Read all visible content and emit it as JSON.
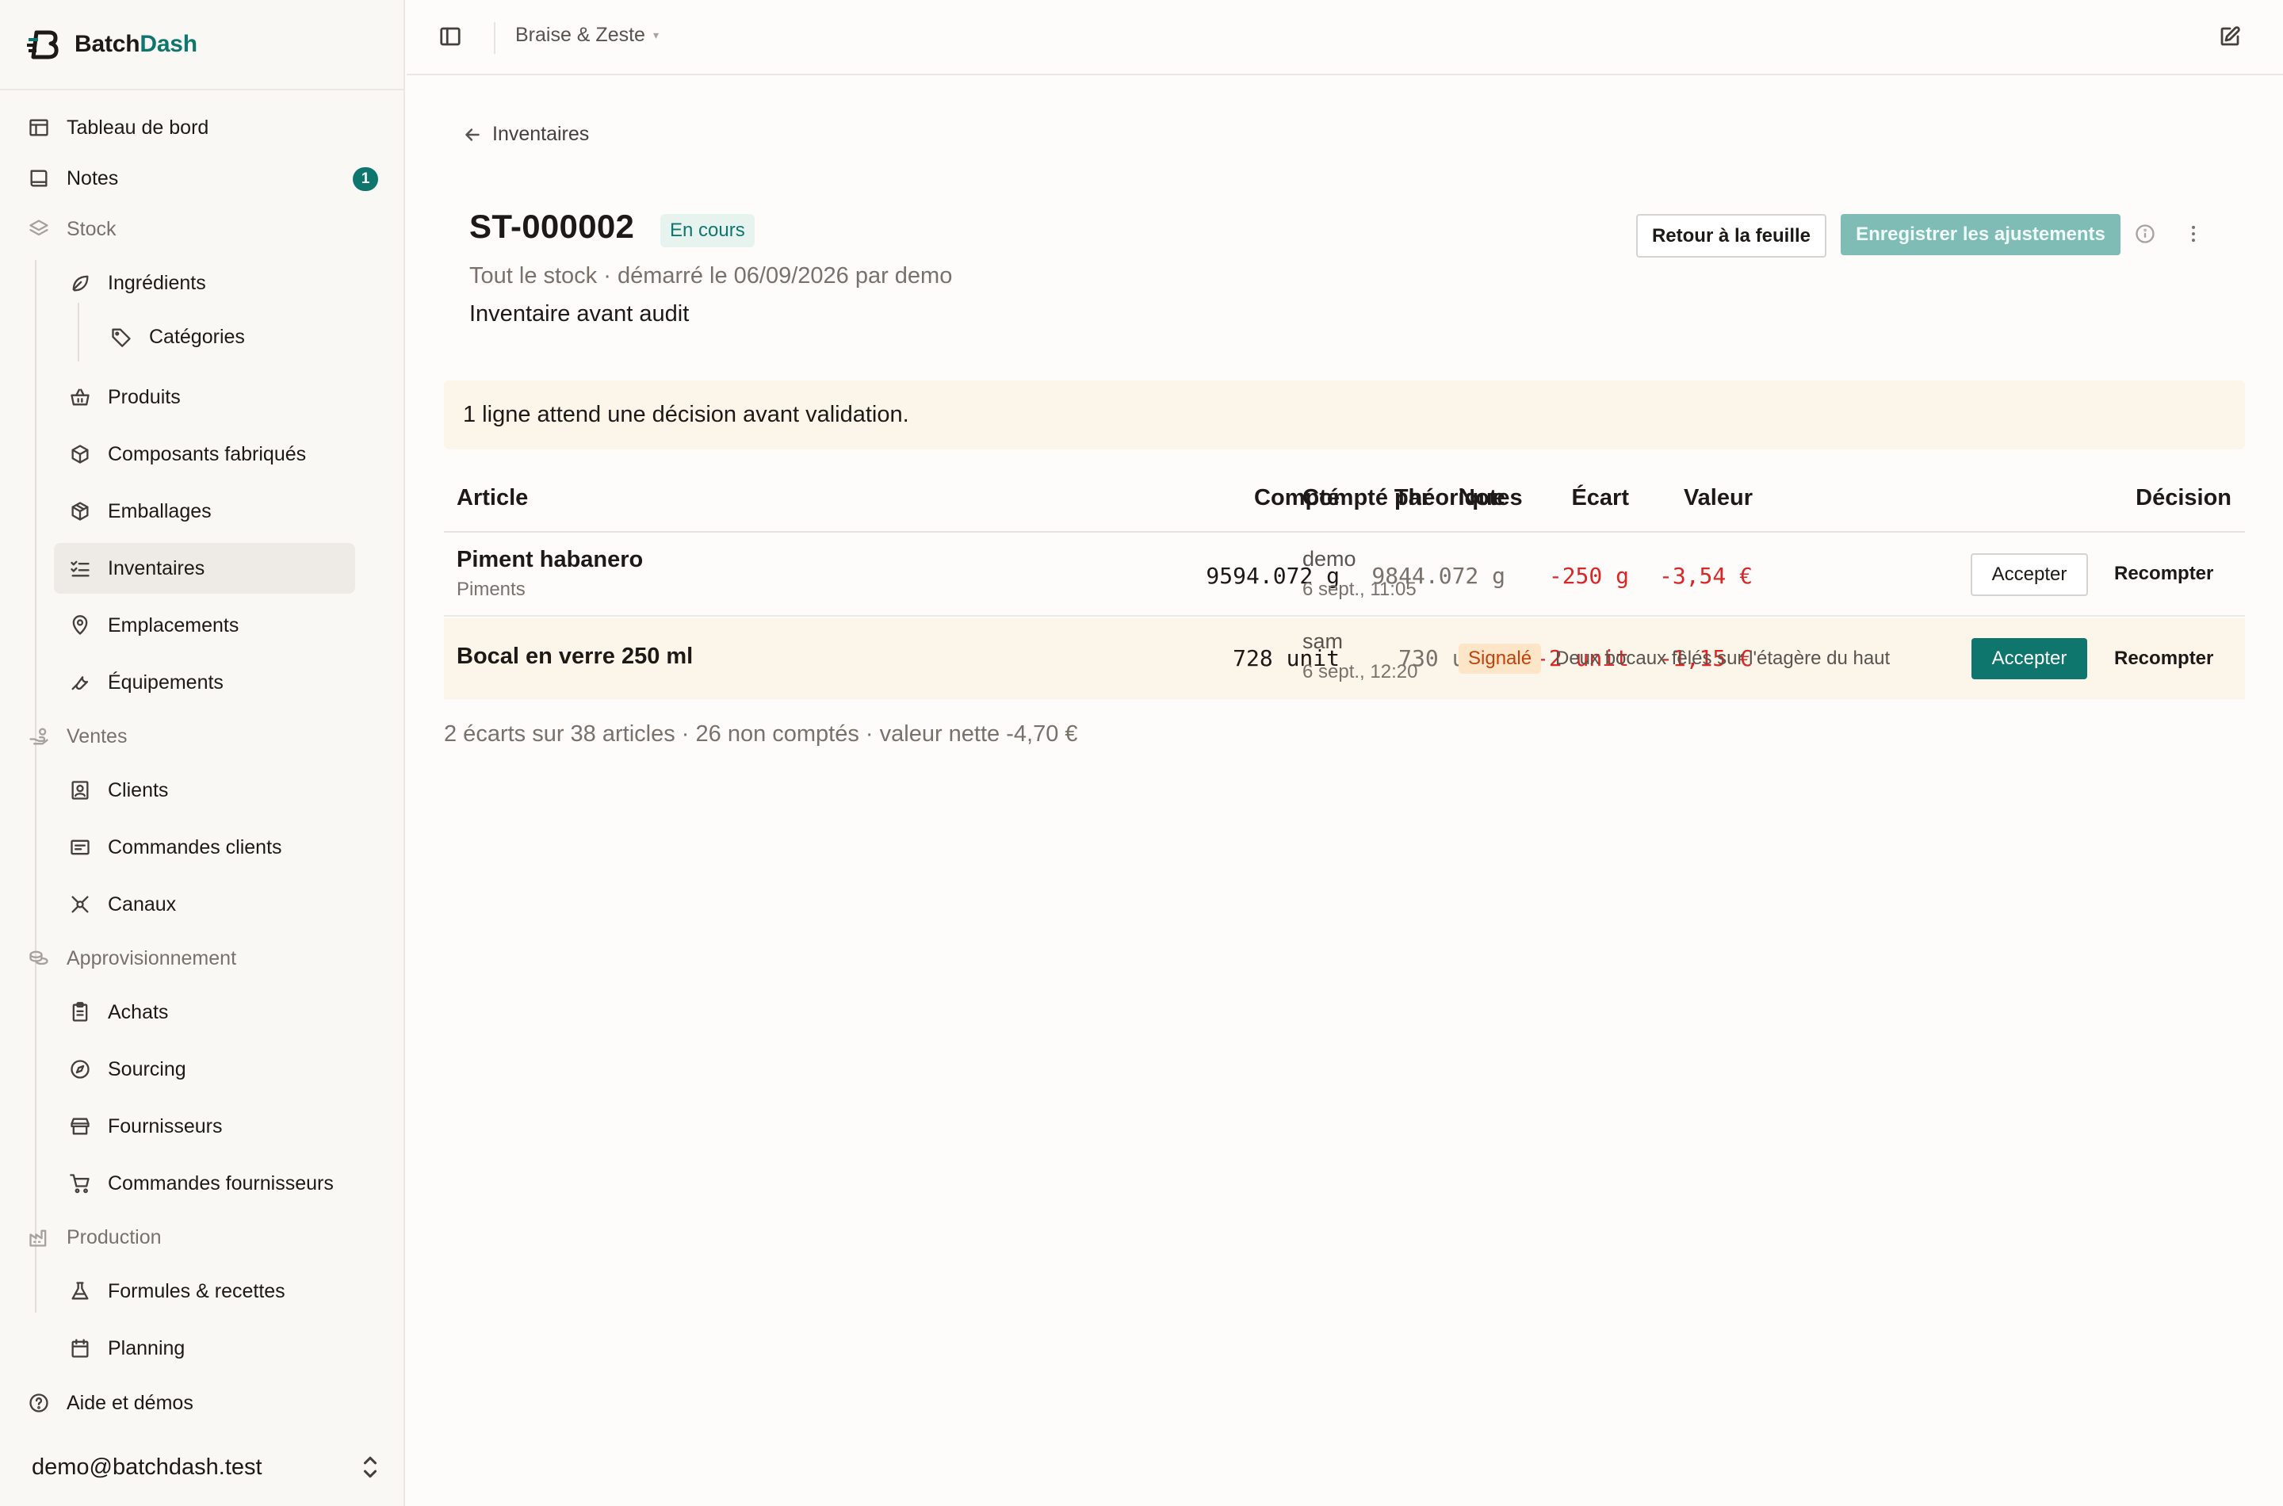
{
  "app": {
    "brand_part1": "Batch",
    "brand_part2": "Dash",
    "accent_color": "#0f766e"
  },
  "sidebar": {
    "dashboard": "Tableau de bord",
    "notes": "Notes",
    "notes_count": "1",
    "stock_section": "Stock",
    "ingredients": "Ingrédients",
    "categories": "Catégories",
    "products": "Produits",
    "components": "Composants fabriqués",
    "packaging": "Emballages",
    "inventories": "Inventaires",
    "locations": "Emplacements",
    "equipment": "Équipements",
    "sales_section": "Ventes",
    "clients": "Clients",
    "client_orders": "Commandes clients",
    "channels": "Canaux",
    "supply_section": "Approvisionnement",
    "purchases": "Achats",
    "sourcing": "Sourcing",
    "suppliers": "Fournisseurs",
    "supplier_orders": "Commandes fournisseurs",
    "production_section": "Production",
    "recipes": "Formules & recettes",
    "planning": "Planning",
    "help": "Aide et démos",
    "user_email": "demo@batchdash.test"
  },
  "topbar": {
    "workspace": "Braise & Zeste"
  },
  "page": {
    "back_label": "Inventaires",
    "title": "ST-000002",
    "status": "En cours",
    "subtitle": "Tout le stock · démarré le 06/09/2026 par demo",
    "description": "Inventaire avant audit",
    "btn_back_sheet": "Retour à la feuille",
    "btn_save": "Enregistrer les ajustements",
    "alert": "1 ligne attend une décision avant validation.",
    "summary": "2 écarts sur 38 articles · 26 non comptés · valeur nette -4,70 €"
  },
  "table": {
    "headers": {
      "article": "Article",
      "counted": "Compté",
      "theoretical": "Théorique",
      "variance": "Écart",
      "value": "Valeur",
      "counted_by": "Compté par",
      "notes": "Notes",
      "decision": "Décision"
    },
    "rows": [
      {
        "name": "Piment habanero",
        "category": "Piments",
        "counted": "9594.072 g",
        "theoretical": "9844.072 g",
        "variance": "-250 g",
        "value": "-3,54 €",
        "by": "demo",
        "date": "6 sept., 11:05",
        "flag": "",
        "note": "",
        "accept": "Accepter",
        "recount": "Recompter"
      },
      {
        "name": "Bocal en verre 250 ml",
        "category": "",
        "counted": "728 unit",
        "theoretical": "730 unit",
        "variance": "-2 unit",
        "value": "-1,15 €",
        "by": "sam",
        "date": "6 sept., 12:20",
        "flag": "Signalé",
        "note": "Deux bocaux fêlés sur l'étagère du haut",
        "accept": "Accepter",
        "recount": "Recompter"
      }
    ]
  }
}
